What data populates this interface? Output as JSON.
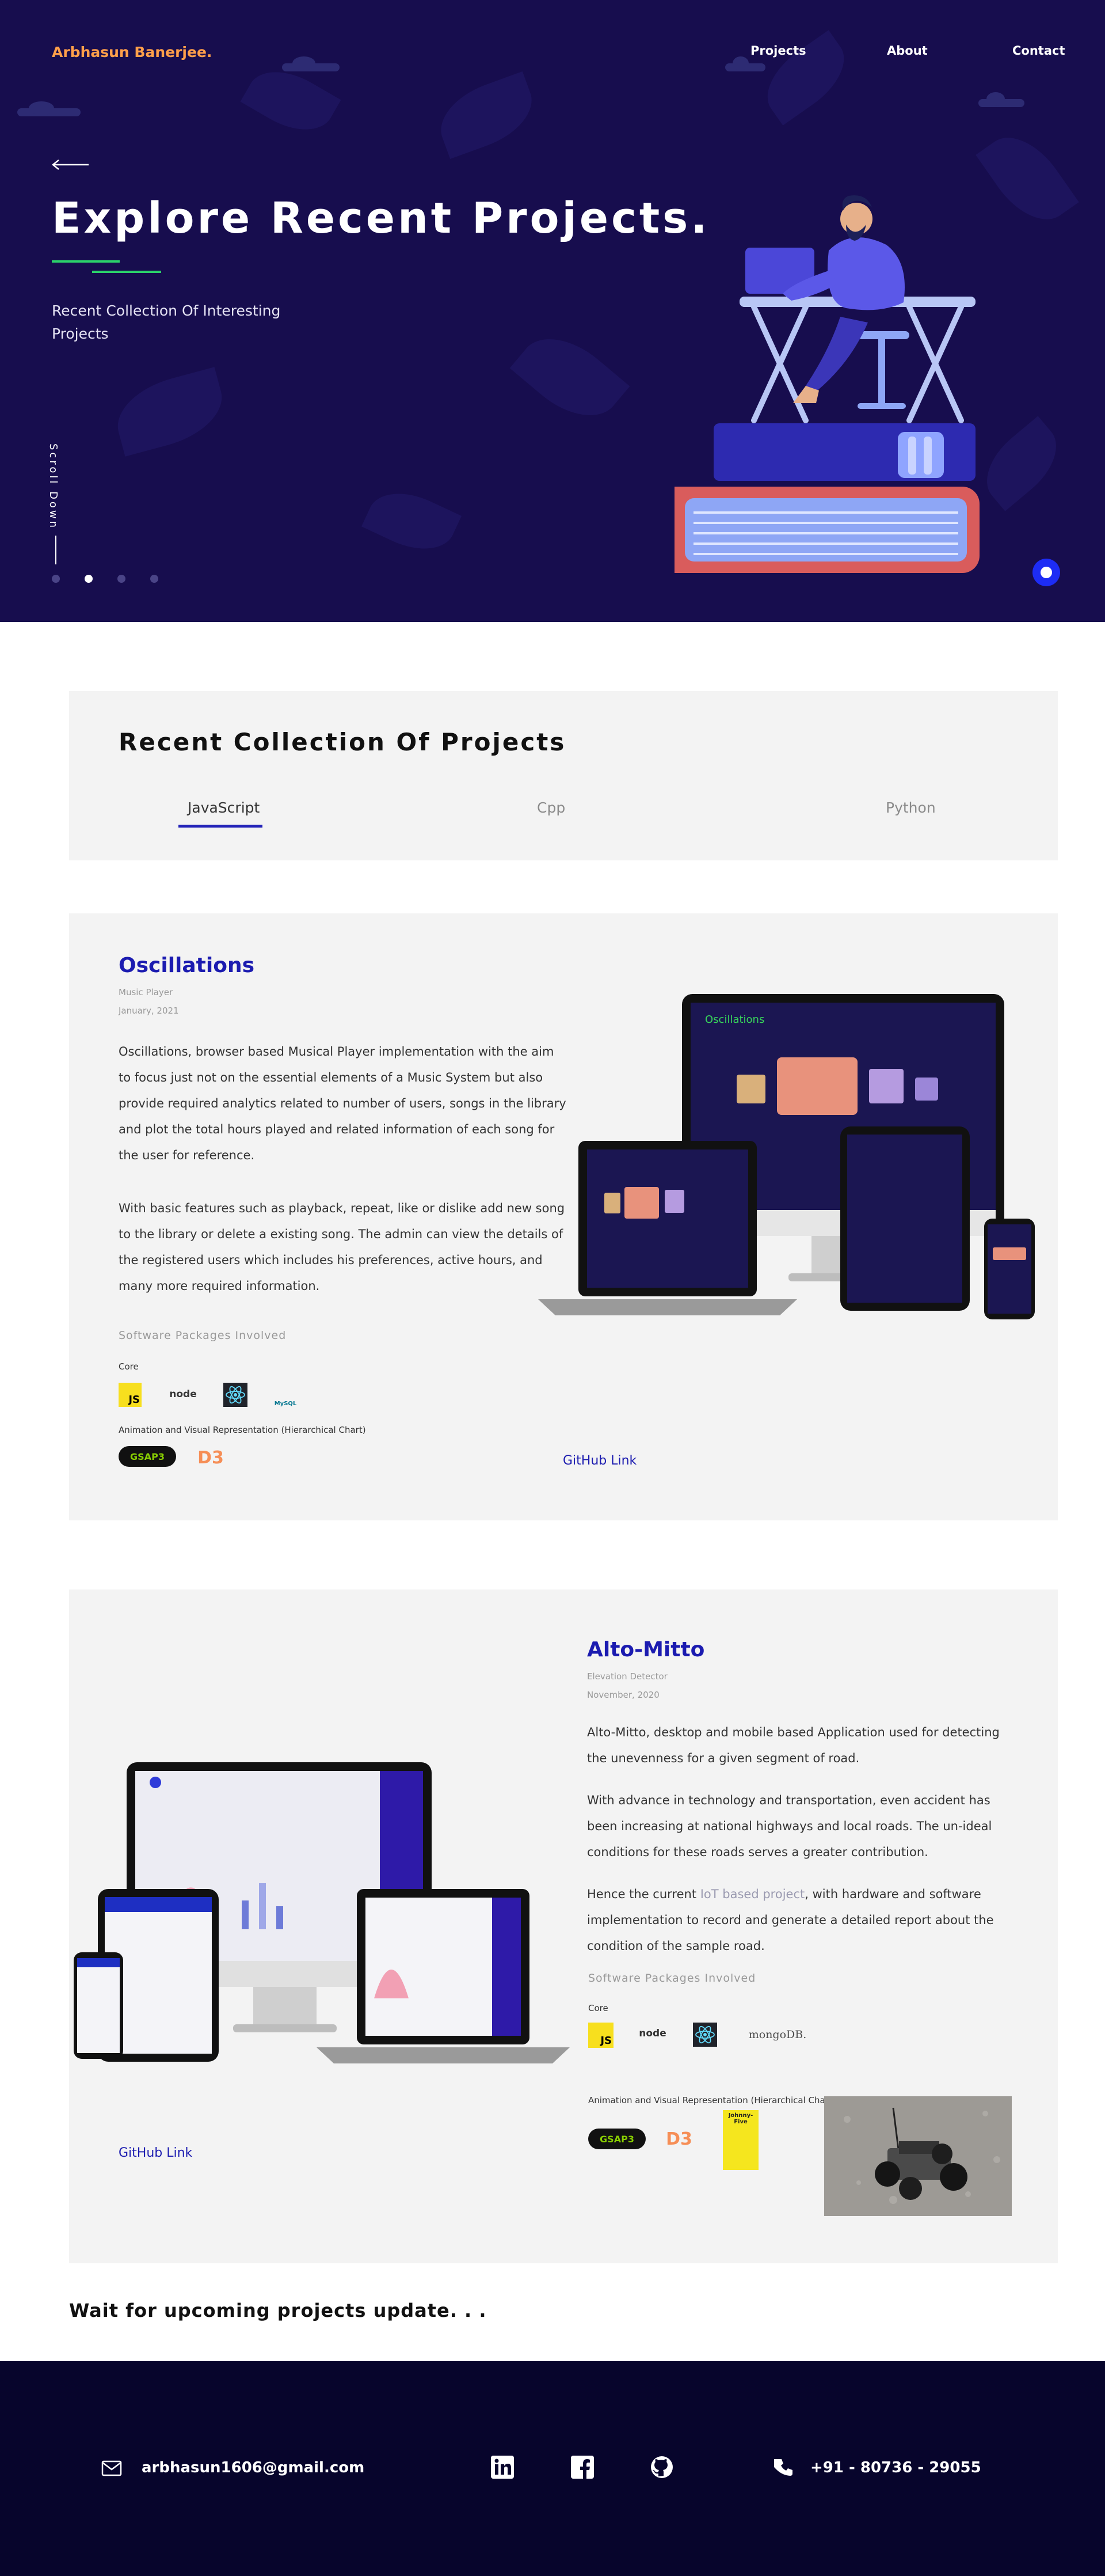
{
  "header": {
    "brand": "Arbhasun Banerjee.",
    "nav": [
      "Projects",
      "About",
      "Contact"
    ]
  },
  "hero": {
    "title": "Explore Recent Projects.",
    "subtitle": "Recent Collection Of Interesting Projects",
    "scroll_label": "Scroll Down",
    "slides_total": 4,
    "slide_active": 2
  },
  "collection": {
    "title": "Recent Collection Of Projects",
    "tabs": [
      "JavaScript",
      "Cpp",
      "Python"
    ],
    "active_tab": "JavaScript"
  },
  "projects": [
    {
      "title": "Oscillations",
      "category": "Music Player",
      "date": "January, 2021",
      "paragraphs": [
        "Oscillations, browser based Musical Player implementation with the aim to focus just not on the essential elements of a Music System but also provide required analytics related to number of users, songs in the library and plot the total hours played and related information of each song for the user for reference.",
        "With basic features such as playback, repeat, like or dislike add new song to the library or delete a existing song. The admin can view the details of the registered users which includes his preferences, active hours, and many more required information."
      ],
      "software_label": "Software Packages Involved",
      "core_label": "Core",
      "core_logos": [
        "JS",
        "node",
        "react",
        "MySQL"
      ],
      "anim_label": "Animation and Visual Representation (Hierarchical Chart)",
      "anim_logos": [
        "GSAP3",
        "D3"
      ],
      "github": "GitHub Link"
    },
    {
      "title": "Alto-Mitto",
      "category": "Elevation Detector",
      "date": "November, 2020",
      "p1": "Alto-Mitto, desktop and mobile based Application used for detecting the unevenness for a given segment of road.",
      "p2": "With advance in technology and transportation, even accident has been increasing at national highways and local roads. The un-ideal conditions for these roads serves a greater contribution.",
      "p3_before": "Hence the current ",
      "p3_link": "IoT based project",
      "p3_after": ", with hardware and software implementation to record and generate a detailed report about the condition of the sample road.",
      "software_label": "Software Packages Involved",
      "core_label": "Core",
      "core_logos": [
        "JS",
        "node",
        "react",
        "mongoDB."
      ],
      "anim_label": "Animation and Visual Representation (Hierarchical Chart)",
      "anim_logos": [
        "GSAP3",
        "D3",
        "Johnny-Five"
      ],
      "github": "GitHub Link"
    }
  ],
  "wait_text": "Wait for upcoming projects update. . .",
  "footer": {
    "email": "arbhasun1606@gmail.com",
    "phone": "+91 - 80736 - 29055"
  },
  "colors": {
    "hero_bg": "#170d4e",
    "brand": "#ff9f4a",
    "accent_green": "#2bd16a",
    "link_blue": "#1b1bb0",
    "footer_bg": "#07052c"
  }
}
